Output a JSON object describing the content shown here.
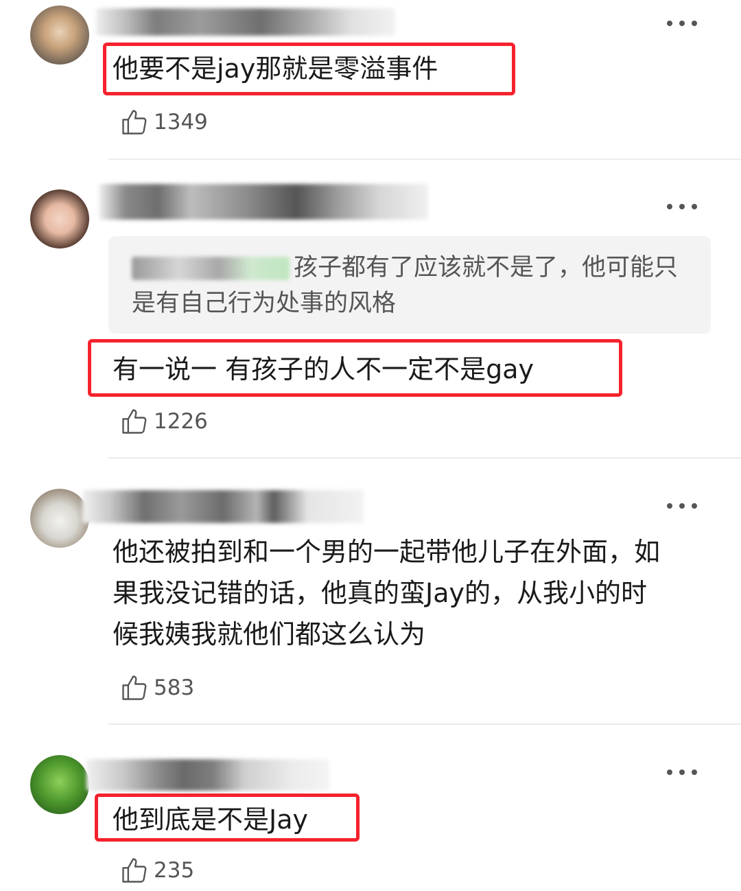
{
  "comments": [
    {
      "text": "他要不是jay那就是零溢事件",
      "likes": "1349"
    },
    {
      "quote": "孩子都有了应该就不是了，他可能只是有自己行为处事的风格",
      "text": "有一说一 有孩子的人不一定不是gay",
      "likes": "1226"
    },
    {
      "text": "他还被拍到和一个男的一起带他儿子在外面，如果我没记错的话，他真的蛮Jay的，从我小的时候我姨我就他们都这么认为",
      "likes": "583"
    },
    {
      "text": "他到底是不是Jay",
      "likes": "235"
    }
  ],
  "colors": {
    "highlight": "#f5222d",
    "quote_bg": "#f3f3f3",
    "divider": "#ececec"
  },
  "icons": {
    "like": "thumbs-up-icon",
    "more": "more-dots-icon"
  }
}
